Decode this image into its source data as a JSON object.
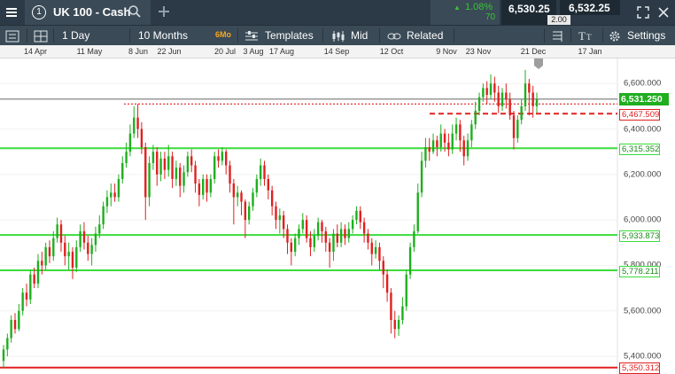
{
  "window": {
    "tab_number": "1",
    "instrument": "UK 100 - Cash",
    "change_pct": "1.08%",
    "change_points": "70",
    "sell_price": "6,530.25",
    "buy_price": "6,532.25",
    "spread": "2.00"
  },
  "toolbar": {
    "interval": "1 Day",
    "range": "10 Months",
    "range_badge": "6Mo",
    "templates_label": "Templates",
    "mid_label": "Mid",
    "related_label": "Related",
    "settings_label": "Settings"
  },
  "dates": [
    "14 Apr",
    "11 May",
    "8 Jun",
    "22 Jun",
    "20 Jul",
    "3 Aug",
    "17 Aug",
    "14 Sep",
    "12 Oct",
    "9 Nov",
    "23 Nov",
    "21 Dec",
    "17 Jan"
  ],
  "chart_data": {
    "type": "candlestick",
    "y_axis_ticks": [
      5400,
      5600,
      5800,
      6000,
      6200,
      6400,
      6600
    ],
    "y_axis_tick_labels": [
      "5,400.000",
      "5,600.000",
      "5,800.000",
      "6,000.000",
      "6,200.000",
      "6,400.000",
      "6,600.000"
    ],
    "ylim": [
      5330,
      6710
    ],
    "current_price": {
      "value": 6531.25,
      "label": "6,531.250",
      "color": "#1fae1f"
    },
    "levels": [
      {
        "value": 6467.509,
        "label": "6,467.509",
        "color": "#e02020",
        "style": "dashed"
      },
      {
        "value": 6315.352,
        "label": "6,315.352",
        "color": "#3bdc3b",
        "style": "solid"
      },
      {
        "value": 5933.873,
        "label": "5,933.873",
        "color": "#3bdc3b",
        "style": "solid"
      },
      {
        "value": 5778.211,
        "label": "5,778.211",
        "color": "#3bdc3b",
        "style": "solid"
      },
      {
        "value": 5350.312,
        "label": "5,350.312",
        "color": "#e02020",
        "style": "solid"
      }
    ],
    "previous_high_level": 6510,
    "up_color": "#1fae1f",
    "down_color": "#e02020",
    "candles": [
      [
        5380,
        5430,
        5350,
        5450
      ],
      [
        5430,
        5480,
        5400,
        5500
      ],
      [
        5480,
        5560,
        5460,
        5580
      ],
      [
        5560,
        5520,
        5500,
        5590
      ],
      [
        5520,
        5600,
        5510,
        5630
      ],
      [
        5600,
        5680,
        5580,
        5700
      ],
      [
        5680,
        5650,
        5620,
        5720
      ],
      [
        5650,
        5760,
        5630,
        5780
      ],
      [
        5760,
        5720,
        5700,
        5790
      ],
      [
        5720,
        5820,
        5700,
        5850
      ],
      [
        5820,
        5800,
        5760,
        5860
      ],
      [
        5800,
        5880,
        5780,
        5900
      ],
      [
        5880,
        5840,
        5810,
        5910
      ],
      [
        5840,
        5920,
        5820,
        5950
      ],
      [
        5920,
        5980,
        5900,
        6010
      ],
      [
        5980,
        5900,
        5860,
        6000
      ],
      [
        5900,
        5840,
        5800,
        5930
      ],
      [
        5840,
        5860,
        5780,
        5900
      ],
      [
        5860,
        5790,
        5740,
        5880
      ],
      [
        5790,
        5880,
        5770,
        5910
      ],
      [
        5880,
        5950,
        5860,
        5980
      ],
      [
        5950,
        5900,
        5870,
        5990
      ],
      [
        5900,
        5850,
        5820,
        5930
      ],
      [
        5850,
        5890,
        5800,
        5920
      ],
      [
        5890,
        5940,
        5860,
        5970
      ],
      [
        5940,
        5980,
        5920,
        6020
      ],
      [
        5980,
        6060,
        5960,
        6080
      ],
      [
        6060,
        6100,
        6030,
        6130
      ],
      [
        6100,
        6120,
        6060,
        6160
      ],
      [
        6120,
        6100,
        6080,
        6160
      ],
      [
        6100,
        6180,
        6080,
        6200
      ],
      [
        6180,
        6250,
        6160,
        6280
      ],
      [
        6250,
        6300,
        6230,
        6340
      ],
      [
        6300,
        6380,
        6280,
        6420
      ],
      [
        6380,
        6450,
        6360,
        6500
      ],
      [
        6450,
        6400,
        6360,
        6510
      ],
      [
        6400,
        6320,
        6290,
        6430
      ],
      [
        6320,
        6100,
        6000,
        6340
      ],
      [
        6100,
        6250,
        6060,
        6280
      ],
      [
        6250,
        6300,
        6220,
        6330
      ],
      [
        6300,
        6200,
        6150,
        6320
      ],
      [
        6200,
        6270,
        6170,
        6300
      ],
      [
        6270,
        6220,
        6180,
        6300
      ],
      [
        6220,
        6280,
        6190,
        6330
      ],
      [
        6280,
        6180,
        6140,
        6300
      ],
      [
        6180,
        6230,
        6150,
        6260
      ],
      [
        6230,
        6150,
        6100,
        6250
      ],
      [
        6150,
        6210,
        6120,
        6240
      ],
      [
        6210,
        6280,
        6190,
        6300
      ],
      [
        6280,
        6240,
        6210,
        6310
      ],
      [
        6240,
        6160,
        6120,
        6260
      ],
      [
        6160,
        6110,
        6060,
        6180
      ],
      [
        6110,
        6180,
        6090,
        6200
      ],
      [
        6180,
        6120,
        6080,
        6200
      ],
      [
        6120,
        6180,
        6100,
        6200
      ],
      [
        6180,
        6280,
        6160,
        6300
      ],
      [
        6280,
        6260,
        6230,
        6310
      ],
      [
        6260,
        6300,
        6240,
        6320
      ],
      [
        6300,
        6240,
        6200,
        6310
      ],
      [
        6240,
        6160,
        6120,
        6260
      ],
      [
        6160,
        6100,
        5980,
        6180
      ],
      [
        6100,
        6120,
        6060,
        6150
      ],
      [
        6120,
        6080,
        6020,
        6130
      ],
      [
        6080,
        6000,
        5920,
        6090
      ],
      [
        6000,
        6060,
        5980,
        6080
      ],
      [
        6060,
        6120,
        6040,
        6140
      ],
      [
        6120,
        6180,
        6100,
        6200
      ],
      [
        6180,
        6240,
        6150,
        6270
      ],
      [
        6240,
        6180,
        6150,
        6260
      ],
      [
        6180,
        6130,
        6090,
        6200
      ],
      [
        6130,
        6060,
        6020,
        6150
      ],
      [
        6060,
        6000,
        5960,
        6080
      ],
      [
        6000,
        6020,
        5940,
        6050
      ],
      [
        6020,
        5960,
        5920,
        6040
      ],
      [
        5960,
        5900,
        5850,
        5980
      ],
      [
        5900,
        5860,
        5800,
        5920
      ],
      [
        5860,
        5920,
        5840,
        5940
      ],
      [
        5920,
        5960,
        5890,
        5980
      ],
      [
        5960,
        6000,
        5940,
        6030
      ],
      [
        6000,
        5920,
        5900,
        6020
      ],
      [
        5920,
        5880,
        5840,
        5950
      ],
      [
        5880,
        5930,
        5860,
        5960
      ],
      [
        5930,
        5990,
        5910,
        6010
      ],
      [
        5990,
        5950,
        5900,
        6000
      ],
      [
        5950,
        5900,
        5860,
        5970
      ],
      [
        5900,
        5860,
        5790,
        5920
      ],
      [
        5860,
        5940,
        5820,
        5960
      ],
      [
        5940,
        5900,
        5880,
        5980
      ],
      [
        5900,
        5960,
        5880,
        5990
      ],
      [
        5960,
        5920,
        5890,
        5980
      ],
      [
        5920,
        5960,
        5900,
        5990
      ],
      [
        5960,
        6000,
        5940,
        6020
      ],
      [
        6000,
        6040,
        5980,
        6060
      ],
      [
        6040,
        5990,
        5960,
        6060
      ],
      [
        5990,
        5940,
        5900,
        6010
      ],
      [
        5940,
        5900,
        5870,
        5960
      ],
      [
        5900,
        5850,
        5800,
        5920
      ],
      [
        5850,
        5880,
        5830,
        5910
      ],
      [
        5880,
        5820,
        5780,
        5900
      ],
      [
        5820,
        5760,
        5700,
        5840
      ],
      [
        5760,
        5680,
        5640,
        5780
      ],
      [
        5680,
        5560,
        5500,
        5700
      ],
      [
        5560,
        5520,
        5480,
        5600
      ],
      [
        5520,
        5560,
        5490,
        5580
      ],
      [
        5560,
        5620,
        5540,
        5660
      ],
      [
        5620,
        5760,
        5600,
        5780
      ],
      [
        5760,
        5880,
        5740,
        5900
      ],
      [
        5880,
        5950,
        5860,
        5980
      ],
      [
        5950,
        6120,
        5940,
        6160
      ],
      [
        6120,
        6260,
        6100,
        6300
      ],
      [
        6260,
        6320,
        6230,
        6360
      ],
      [
        6320,
        6300,
        6260,
        6360
      ],
      [
        6300,
        6350,
        6290,
        6380
      ],
      [
        6350,
        6320,
        6280,
        6370
      ],
      [
        6320,
        6380,
        6300,
        6420
      ],
      [
        6380,
        6340,
        6300,
        6400
      ],
      [
        6340,
        6310,
        6280,
        6380
      ],
      [
        6310,
        6380,
        6290,
        6420
      ],
      [
        6380,
        6420,
        6350,
        6450
      ],
      [
        6420,
        6350,
        6300,
        6440
      ],
      [
        6350,
        6280,
        6240,
        6370
      ],
      [
        6280,
        6350,
        6260,
        6380
      ],
      [
        6350,
        6420,
        6320,
        6440
      ],
      [
        6420,
        6480,
        6400,
        6520
      ],
      [
        6480,
        6540,
        6460,
        6560
      ],
      [
        6540,
        6580,
        6520,
        6600
      ],
      [
        6580,
        6550,
        6510,
        6610
      ],
      [
        6550,
        6600,
        6530,
        6640
      ],
      [
        6600,
        6560,
        6520,
        6630
      ],
      [
        6560,
        6500,
        6470,
        6590
      ],
      [
        6500,
        6560,
        6480,
        6580
      ],
      [
        6560,
        6530,
        6490,
        6600
      ],
      [
        6530,
        6460,
        6440,
        6560
      ],
      [
        6460,
        6360,
        6310,
        6480
      ],
      [
        6360,
        6440,
        6340,
        6460
      ],
      [
        6440,
        6500,
        6420,
        6530
      ],
      [
        6500,
        6600,
        6480,
        6660
      ],
      [
        6600,
        6560,
        6460,
        6620
      ],
      [
        6560,
        6500,
        6450,
        6590
      ],
      [
        6500,
        6531,
        6470,
        6560
      ]
    ]
  }
}
